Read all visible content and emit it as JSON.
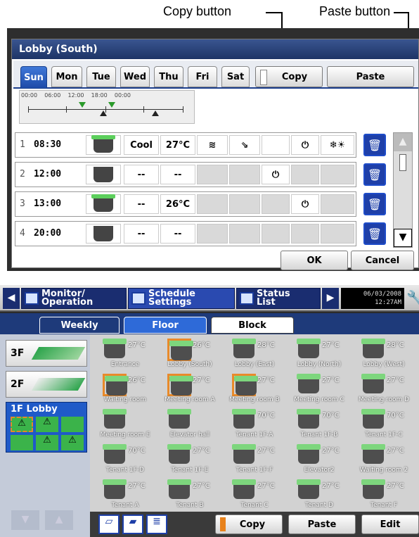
{
  "callouts": {
    "copy": "Copy button",
    "paste": "Paste button"
  },
  "dialog": {
    "title": "Lobby (South)",
    "days": [
      "Sun",
      "Mon",
      "Tue",
      "Wed",
      "Thu",
      "Fri",
      "Sat"
    ],
    "selected_day": "Sun",
    "copy_label": "Copy",
    "paste_label": "Paste",
    "timeline_hours": "00:00    06:00    12:00    18:00    00:00",
    "rows": [
      {
        "num": "1",
        "time": "08:30",
        "mode": "Cool",
        "temp": "27°C",
        "ac": "on",
        "power": "⏻",
        "extra": "❄☀"
      },
      {
        "num": "2",
        "time": "12:00",
        "mode": "--",
        "temp": "--",
        "ac": "off",
        "power": "⏻",
        "extra": ""
      },
      {
        "num": "3",
        "time": "13:00",
        "mode": "--",
        "temp": "26°C",
        "ac": "on",
        "power": "⏻",
        "extra": ""
      },
      {
        "num": "4",
        "time": "20:00",
        "mode": "--",
        "temp": "--",
        "ac": "off",
        "power": "",
        "extra": ""
      }
    ],
    "ok_label": "OK",
    "cancel_label": "Cancel"
  },
  "panel": {
    "nav": {
      "monitor": "Monitor/\nOperation",
      "schedule": "Schedule\nSettings",
      "status": "Status\nList"
    },
    "date": "06/03/2008",
    "time": "12:27AM",
    "subtabs": [
      "Weekly",
      "Floor",
      "Block"
    ],
    "floors": [
      {
        "label": "3F"
      },
      {
        "label": "2F"
      },
      {
        "label": "1F Lobby"
      }
    ],
    "units": [
      {
        "name": "Entrance",
        "temp": "27°C",
        "sel": false
      },
      {
        "name": "Lobby (South)",
        "temp": "26°C",
        "sel": true
      },
      {
        "name": "Lobby (East)",
        "temp": "28°C",
        "sel": false
      },
      {
        "name": "Lobby (North)",
        "temp": "27°C",
        "sel": false
      },
      {
        "name": "Lobby (West)",
        "temp": "28°C",
        "sel": false
      },
      {
        "name": "Waiting room",
        "temp": "26°C",
        "sel": true
      },
      {
        "name": "Meeting room A",
        "temp": "27°C",
        "sel": true
      },
      {
        "name": "Meeting room B",
        "temp": "27°C",
        "sel": true
      },
      {
        "name": "Meeting room C",
        "temp": "27°C",
        "sel": false
      },
      {
        "name": "Meeting room D",
        "temp": "27°C",
        "sel": false
      },
      {
        "name": "Meeting room E",
        "temp": "",
        "sel": false
      },
      {
        "name": "Elevator hall",
        "temp": "",
        "sel": false
      },
      {
        "name": "Tenant 1F-A",
        "temp": "70°C",
        "sel": false
      },
      {
        "name": "Tenant 1F-B",
        "temp": "70°C",
        "sel": false
      },
      {
        "name": "Tenant 1F-C",
        "temp": "70°C",
        "sel": false
      },
      {
        "name": "Tenant 1F-D",
        "temp": "70°C",
        "sel": false
      },
      {
        "name": "Tenant 1F-E",
        "temp": "27°C",
        "sel": false
      },
      {
        "name": "Tenant 1F-F",
        "temp": "27°C",
        "sel": false
      },
      {
        "name": "Elevator2",
        "temp": "27°C",
        "sel": false
      },
      {
        "name": "Waiting room 2",
        "temp": "27°C",
        "sel": false
      },
      {
        "name": "Tenant A",
        "temp": "27°C",
        "sel": false
      },
      {
        "name": "Tenant B",
        "temp": "27°C",
        "sel": false
      },
      {
        "name": "Tenant C",
        "temp": "27°C",
        "sel": false
      },
      {
        "name": "Tenant D",
        "temp": "27°C",
        "sel": false
      },
      {
        "name": "Tenant F",
        "temp": "27°C",
        "sel": false
      }
    ],
    "bottom": {
      "copy": "Copy",
      "paste": "Paste",
      "edit": "Edit"
    }
  }
}
